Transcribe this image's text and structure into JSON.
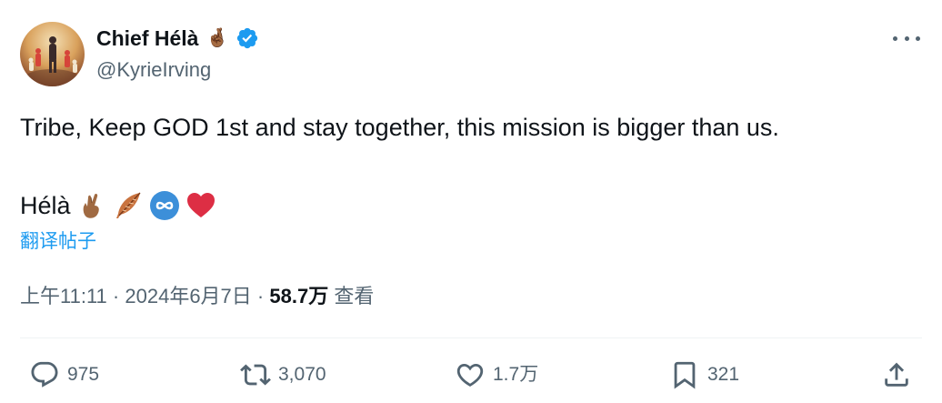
{
  "author": {
    "display_name": "Chief Hélà",
    "name_emoji": "🤞🏾",
    "handle": "@KyrieIrving",
    "verified_icon": "verified-badge-icon",
    "verified_color": "#1d9bf0"
  },
  "tweet": {
    "text": "Tribe, Keep GOD 1st and stay together, this mission is bigger than us.",
    "signature": "Hélà",
    "signature_emojis": [
      "crossed-fingers-icon",
      "feather-icon",
      "infinity-icon",
      "red-heart-icon"
    ],
    "translate_link": "翻译帖子"
  },
  "meta": {
    "time": "上午11:11",
    "separator": "·",
    "date": "2024年6月7日",
    "views_count": "58.7万",
    "views_label": "查看"
  },
  "actions": {
    "reply": {
      "icon": "reply-icon",
      "count": "975"
    },
    "retweet": {
      "icon": "retweet-icon",
      "count": "3,070"
    },
    "like": {
      "icon": "heart-icon",
      "count": "1.7万"
    },
    "bookmark": {
      "icon": "bookmark-icon",
      "count": "321"
    },
    "share": {
      "icon": "share-icon"
    }
  },
  "colors": {
    "text": "#0f1419",
    "secondary": "#536471",
    "link": "#1d9bf0",
    "divider": "#eff3f4"
  }
}
